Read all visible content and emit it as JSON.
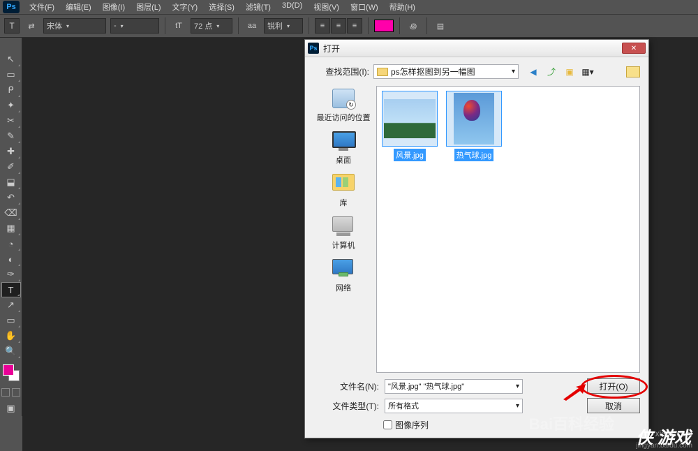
{
  "app": {
    "logo": "Ps"
  },
  "menu": {
    "items": [
      "文件(F)",
      "编辑(E)",
      "图像(I)",
      "图层(L)",
      "文字(Y)",
      "选择(S)",
      "滤镜(T)",
      "3D(D)",
      "视图(V)",
      "窗口(W)",
      "帮助(H)"
    ]
  },
  "options": {
    "tool": "T",
    "swap": "⇄",
    "font_family": "宋体",
    "font_style": "-",
    "size_icon": "tT",
    "size_value": "72 点",
    "aa_icon": "aa",
    "aa_method": "锐利"
  },
  "tools": [
    {
      "g": "↖",
      "name": "move-tool"
    },
    {
      "g": "▭",
      "name": "marquee-tool"
    },
    {
      "g": "ᑭ",
      "name": "lasso-tool"
    },
    {
      "g": "✦",
      "name": "quick-select-tool"
    },
    {
      "g": "✂",
      "name": "crop-tool"
    },
    {
      "g": "✎",
      "name": "eyedropper-tool"
    },
    {
      "g": "✚",
      "name": "healing-tool"
    },
    {
      "g": "✐",
      "name": "brush-tool"
    },
    {
      "g": "⬓",
      "name": "stamp-tool"
    },
    {
      "g": "↶",
      "name": "history-brush-tool"
    },
    {
      "g": "⌫",
      "name": "eraser-tool"
    },
    {
      "g": "▦",
      "name": "gradient-tool"
    },
    {
      "g": "◔",
      "name": "blur-tool"
    },
    {
      "g": "◐",
      "name": "dodge-tool"
    },
    {
      "g": "✑",
      "name": "pen-tool"
    },
    {
      "g": "T",
      "name": "type-tool",
      "active": true
    },
    {
      "g": "↗",
      "name": "path-select-tool"
    },
    {
      "g": "▭",
      "name": "rectangle-tool"
    },
    {
      "g": "✋",
      "name": "hand-tool"
    },
    {
      "g": "🔍",
      "name": "zoom-tool"
    }
  ],
  "dialog": {
    "title": "打开",
    "lookin_label": "查找范围(I):",
    "lookin_value": "ps怎样抠图到另一幅图",
    "places": [
      {
        "label": "最近访问的位置",
        "name": "recent"
      },
      {
        "label": "桌面",
        "name": "desktop"
      },
      {
        "label": "库",
        "name": "libraries"
      },
      {
        "label": "计算机",
        "name": "computer"
      },
      {
        "label": "网络",
        "name": "network"
      }
    ],
    "files": [
      {
        "label": "风景.jpg",
        "name": "file-landscape",
        "selected": true,
        "cls": "img1"
      },
      {
        "label": "热气球.jpg",
        "name": "file-balloon",
        "selected": true,
        "cls": "img2"
      }
    ],
    "filename_label": "文件名(N):",
    "filename_value": "\"风景.jpg\" \"热气球.jpg\"",
    "filetype_label": "文件类型(T):",
    "filetype_value": "所有格式",
    "open_btn": "打开(O)",
    "cancel_btn": "取消",
    "sequence_checkbox": "图像序列"
  },
  "watermarks": {
    "site": "xiayx.com",
    "url": "jingyan.baidu.com",
    "game": "侠 游戏",
    "baidu": "Bai百科经验"
  }
}
